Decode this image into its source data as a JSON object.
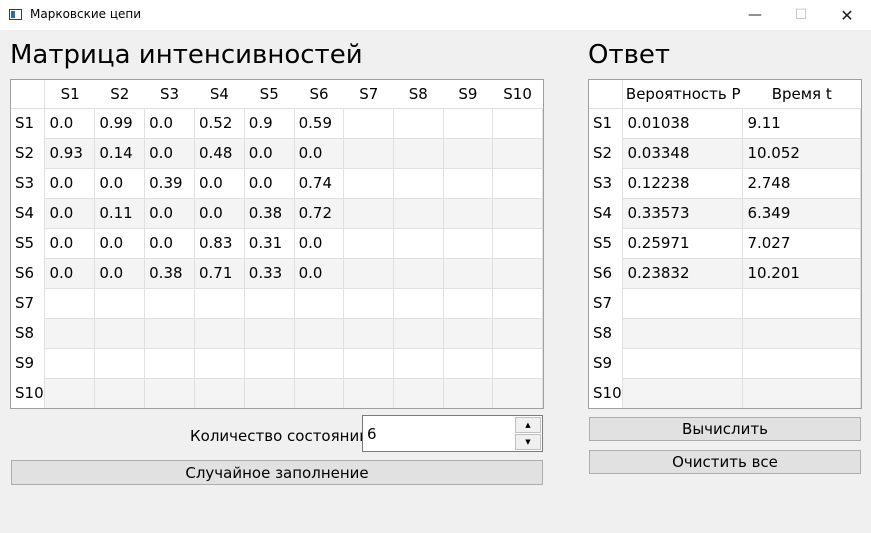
{
  "window": {
    "title": "Марковские цепи",
    "minimize_glyph": "—",
    "maximize_glyph": "☐",
    "close_glyph": "✕"
  },
  "matrix": {
    "heading": "Матрица интенсивностей",
    "columns": [
      "S1",
      "S2",
      "S3",
      "S4",
      "S5",
      "S6",
      "S7",
      "S8",
      "S9",
      "S10"
    ],
    "row_labels": [
      "S1",
      "S2",
      "S3",
      "S4",
      "S5",
      "S6",
      "S7",
      "S8",
      "S9",
      "S10"
    ],
    "rows": [
      [
        "0.0",
        "0.99",
        "0.0",
        "0.52",
        "0.9",
        "0.59",
        "",
        "",
        "",
        ""
      ],
      [
        "0.93",
        "0.14",
        "0.0",
        "0.48",
        "0.0",
        "0.0",
        "",
        "",
        "",
        ""
      ],
      [
        "0.0",
        "0.0",
        "0.39",
        "0.0",
        "0.0",
        "0.74",
        "",
        "",
        "",
        ""
      ],
      [
        "0.0",
        "0.11",
        "0.0",
        "0.0",
        "0.38",
        "0.72",
        "",
        "",
        "",
        ""
      ],
      [
        "0.0",
        "0.0",
        "0.0",
        "0.83",
        "0.31",
        "0.0",
        "",
        "",
        "",
        ""
      ],
      [
        "0.0",
        "0.0",
        "0.38",
        "0.71",
        "0.33",
        "0.0",
        "",
        "",
        "",
        ""
      ],
      [
        "",
        "",
        "",
        "",
        "",
        "",
        "",
        "",
        "",
        ""
      ],
      [
        "",
        "",
        "",
        "",
        "",
        "",
        "",
        "",
        "",
        ""
      ],
      [
        "",
        "",
        "",
        "",
        "",
        "",
        "",
        "",
        "",
        ""
      ],
      [
        "",
        "",
        "",
        "",
        "",
        "",
        "",
        "",
        "",
        ""
      ]
    ]
  },
  "states": {
    "label": "Количество состояний",
    "value": "6",
    "up_glyph": "▲",
    "down_glyph": "▼"
  },
  "random_fill_button": "Случайное заполнение",
  "answer": {
    "heading": "Ответ",
    "columns": [
      "Вероятность P",
      "Время t"
    ],
    "row_labels": [
      "S1",
      "S2",
      "S3",
      "S4",
      "S5",
      "S6",
      "S7",
      "S8",
      "S9",
      "S10"
    ],
    "rows": [
      [
        "0.01038",
        "9.11"
      ],
      [
        "0.03348",
        "10.052"
      ],
      [
        "0.12238",
        "2.748"
      ],
      [
        "0.33573",
        "6.349"
      ],
      [
        "0.25971",
        "7.027"
      ],
      [
        "0.23832",
        "10.201"
      ],
      [
        "",
        ""
      ],
      [
        "",
        ""
      ],
      [
        "",
        ""
      ],
      [
        "",
        ""
      ]
    ]
  },
  "compute_button": "Вычислить",
  "clear_button": "Очистить все"
}
